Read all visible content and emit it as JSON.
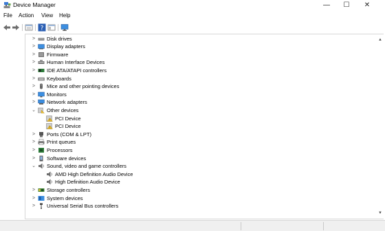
{
  "window": {
    "title": "Device Manager",
    "minimize_glyph": "—",
    "maximize_glyph": "☐",
    "close_glyph": "✕",
    "app_icon": "device-manager-icon"
  },
  "menu": {
    "items": [
      "File",
      "Action",
      "View",
      "Help"
    ]
  },
  "toolbar": {
    "items": [
      {
        "name": "back-button",
        "icon": "back-arrow-icon"
      },
      {
        "name": "forward-button",
        "icon": "forward-arrow-icon"
      },
      {
        "name": "properties-button",
        "icon": "properties-icon"
      },
      {
        "name": "help-button",
        "icon": "help-icon"
      },
      {
        "name": "show-hide-button",
        "icon": "show-hide-console-tree-icon"
      },
      {
        "name": "monitor-button",
        "icon": "monitor-icon"
      }
    ]
  },
  "tree": {
    "expand_glyph": ">",
    "collapse_glyph": "⌄",
    "nodes": [
      {
        "label": "Disk drives",
        "level": 0,
        "expanded": false,
        "icon": "disk-drive-icon"
      },
      {
        "label": "Display adapters",
        "level": 0,
        "expanded": false,
        "icon": "display-adapter-icon"
      },
      {
        "label": "Firmware",
        "level": 0,
        "expanded": false,
        "icon": "firmware-icon"
      },
      {
        "label": "Human Interface Devices",
        "level": 0,
        "expanded": false,
        "icon": "hid-icon"
      },
      {
        "label": "IDE ATA/ATAPI controllers",
        "level": 0,
        "expanded": false,
        "icon": "ide-controller-icon"
      },
      {
        "label": "Keyboards",
        "level": 0,
        "expanded": false,
        "icon": "keyboard-icon"
      },
      {
        "label": "Mice and other pointing devices",
        "level": 0,
        "expanded": false,
        "icon": "mouse-icon"
      },
      {
        "label": "Monitors",
        "level": 0,
        "expanded": false,
        "icon": "monitor-icon"
      },
      {
        "label": "Network adapters",
        "level": 0,
        "expanded": false,
        "icon": "network-adapter-icon"
      },
      {
        "label": "Other devices",
        "level": 0,
        "expanded": true,
        "icon": "other-devices-icon"
      },
      {
        "label": "PCI Device",
        "level": 1,
        "expanded": null,
        "icon": "unknown-device-warning-icon"
      },
      {
        "label": "PCI Device",
        "level": 1,
        "expanded": null,
        "icon": "unknown-device-warning-icon"
      },
      {
        "label": "Ports (COM & LPT)",
        "level": 0,
        "expanded": false,
        "icon": "port-icon"
      },
      {
        "label": "Print queues",
        "level": 0,
        "expanded": false,
        "icon": "printer-icon"
      },
      {
        "label": "Processors",
        "level": 0,
        "expanded": false,
        "icon": "processor-icon"
      },
      {
        "label": "Software devices",
        "level": 0,
        "expanded": false,
        "icon": "software-device-icon"
      },
      {
        "label": "Sound, video and game controllers",
        "level": 0,
        "expanded": true,
        "icon": "speaker-icon"
      },
      {
        "label": "AMD High Definition Audio Device",
        "level": 1,
        "expanded": null,
        "icon": "speaker-icon"
      },
      {
        "label": "High Definition Audio Device",
        "level": 1,
        "expanded": null,
        "icon": "speaker-icon"
      },
      {
        "label": "Storage controllers",
        "level": 0,
        "expanded": false,
        "icon": "storage-controller-icon"
      },
      {
        "label": "System devices",
        "level": 0,
        "expanded": false,
        "icon": "system-devices-icon"
      },
      {
        "label": "Universal Serial Bus controllers",
        "level": 0,
        "expanded": false,
        "icon": "usb-icon"
      }
    ]
  },
  "scrollbar": {
    "up_glyph": "▲",
    "down_glyph": "▼"
  },
  "colors": {
    "accent_blue": "#1e6fd9",
    "warning_yellow": "#f2c12e",
    "toolbar_gray": "#6e6e6e"
  }
}
